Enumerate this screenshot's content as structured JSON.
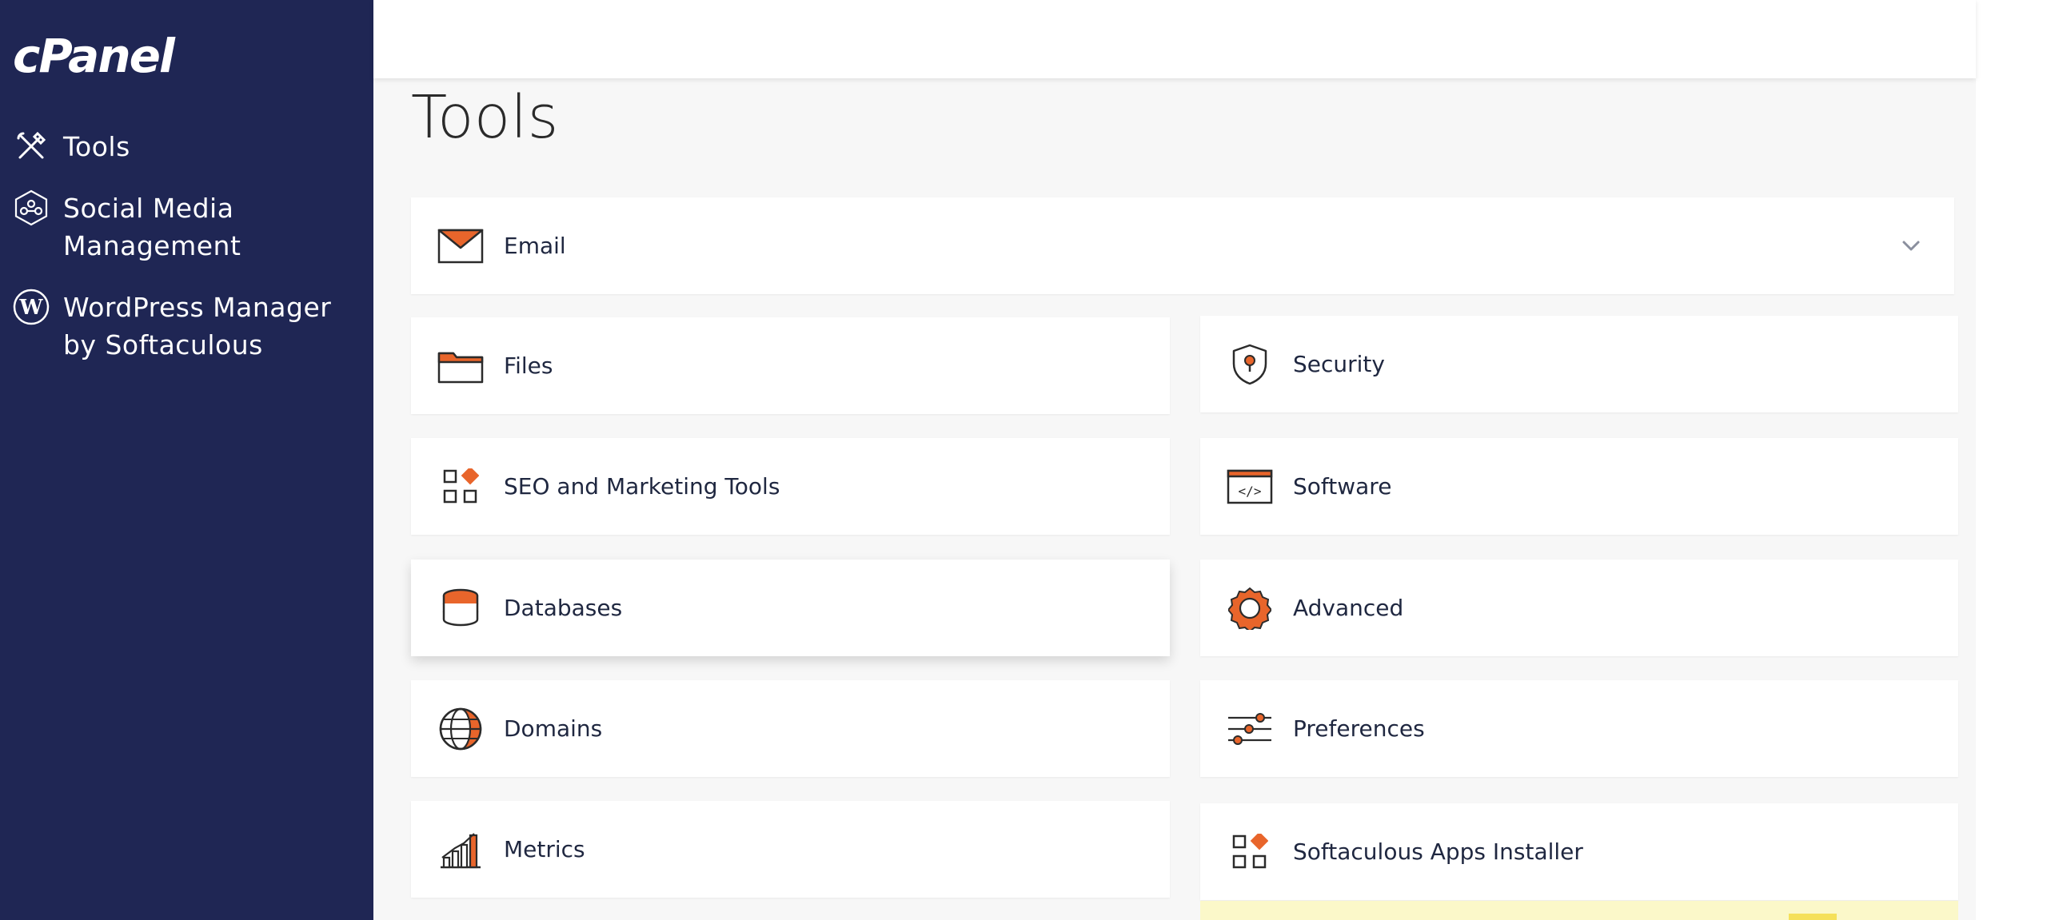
{
  "brand": {
    "logo_text": "cPanel"
  },
  "sidebar": {
    "items": [
      {
        "label_line1": "Tools",
        "label_line2": "",
        "icon": "tools-icon"
      },
      {
        "label_line1": "Social Media",
        "label_line2": "Management",
        "icon": "social-media-icon"
      },
      {
        "label_line1": "WordPress Manager",
        "label_line2": "by Softaculous",
        "icon": "wordpress-icon"
      }
    ]
  },
  "main": {
    "title": "Tools",
    "sections": {
      "email": "Email",
      "files": "Files",
      "security": "Security",
      "seo": "SEO and Marketing Tools",
      "software": "Software",
      "databases": "Databases",
      "advanced": "Advanced",
      "domains": "Domains",
      "preferences": "Preferences",
      "metrics": "Metrics",
      "softaculous": "Softaculous Apps Installer"
    }
  },
  "colors": {
    "sidebar_bg": "#1f2654",
    "accent_orange": "#e8652b",
    "text_dark": "#1f2740"
  }
}
